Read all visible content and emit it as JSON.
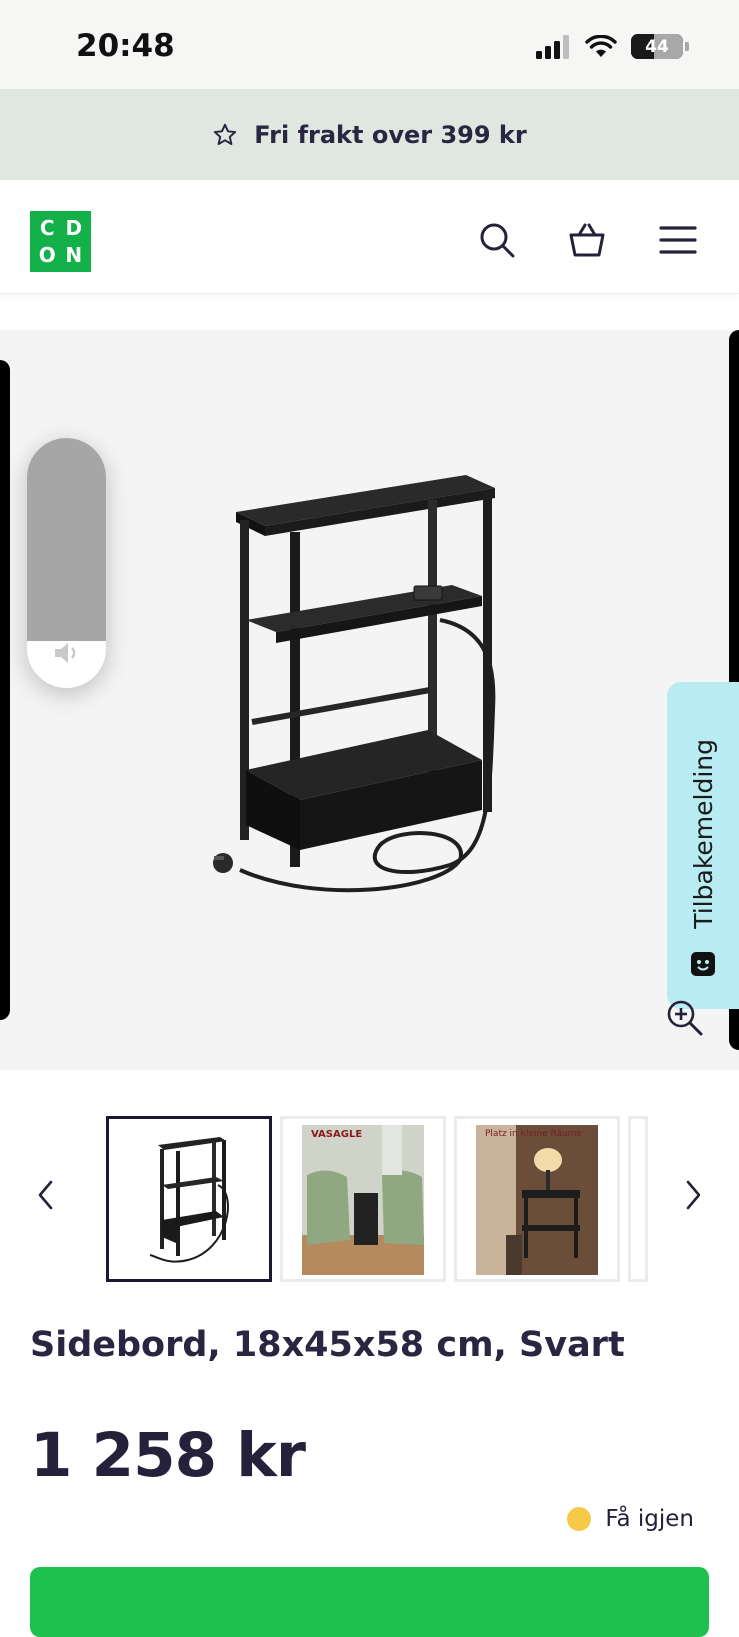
{
  "status_bar": {
    "time": "20:48",
    "battery": "44",
    "battery_level": 0.44
  },
  "promo": {
    "text": "Fri frakt over 399 kr"
  },
  "header": {
    "logo_letters": [
      "C",
      "D",
      "O",
      "N"
    ],
    "icons": [
      "search-icon",
      "basket-icon",
      "hamburger-menu-icon"
    ]
  },
  "volume_hud": {
    "level": 0.81
  },
  "feedback": {
    "label": "Tilbakemelding"
  },
  "thumbnails": [
    {
      "name": "thumb-product",
      "active": true
    },
    {
      "name": "thumb-living-room",
      "overlay_text": "VASAGLE"
    },
    {
      "name": "thumb-lamp",
      "overlay_text": "Platz in kleine Räume"
    }
  ],
  "product": {
    "title": "Sidebord, 18x45x58 cm, Svart",
    "price": "1 258 kr",
    "stock_status": "Få igjen"
  },
  "colors": {
    "accent_green": "#1ec14d",
    "logo_green": "#14b14a",
    "stock_yellow": "#f7c948",
    "promo_bg": "#dfe7e0",
    "feedback_bg": "#b9ecf2"
  }
}
